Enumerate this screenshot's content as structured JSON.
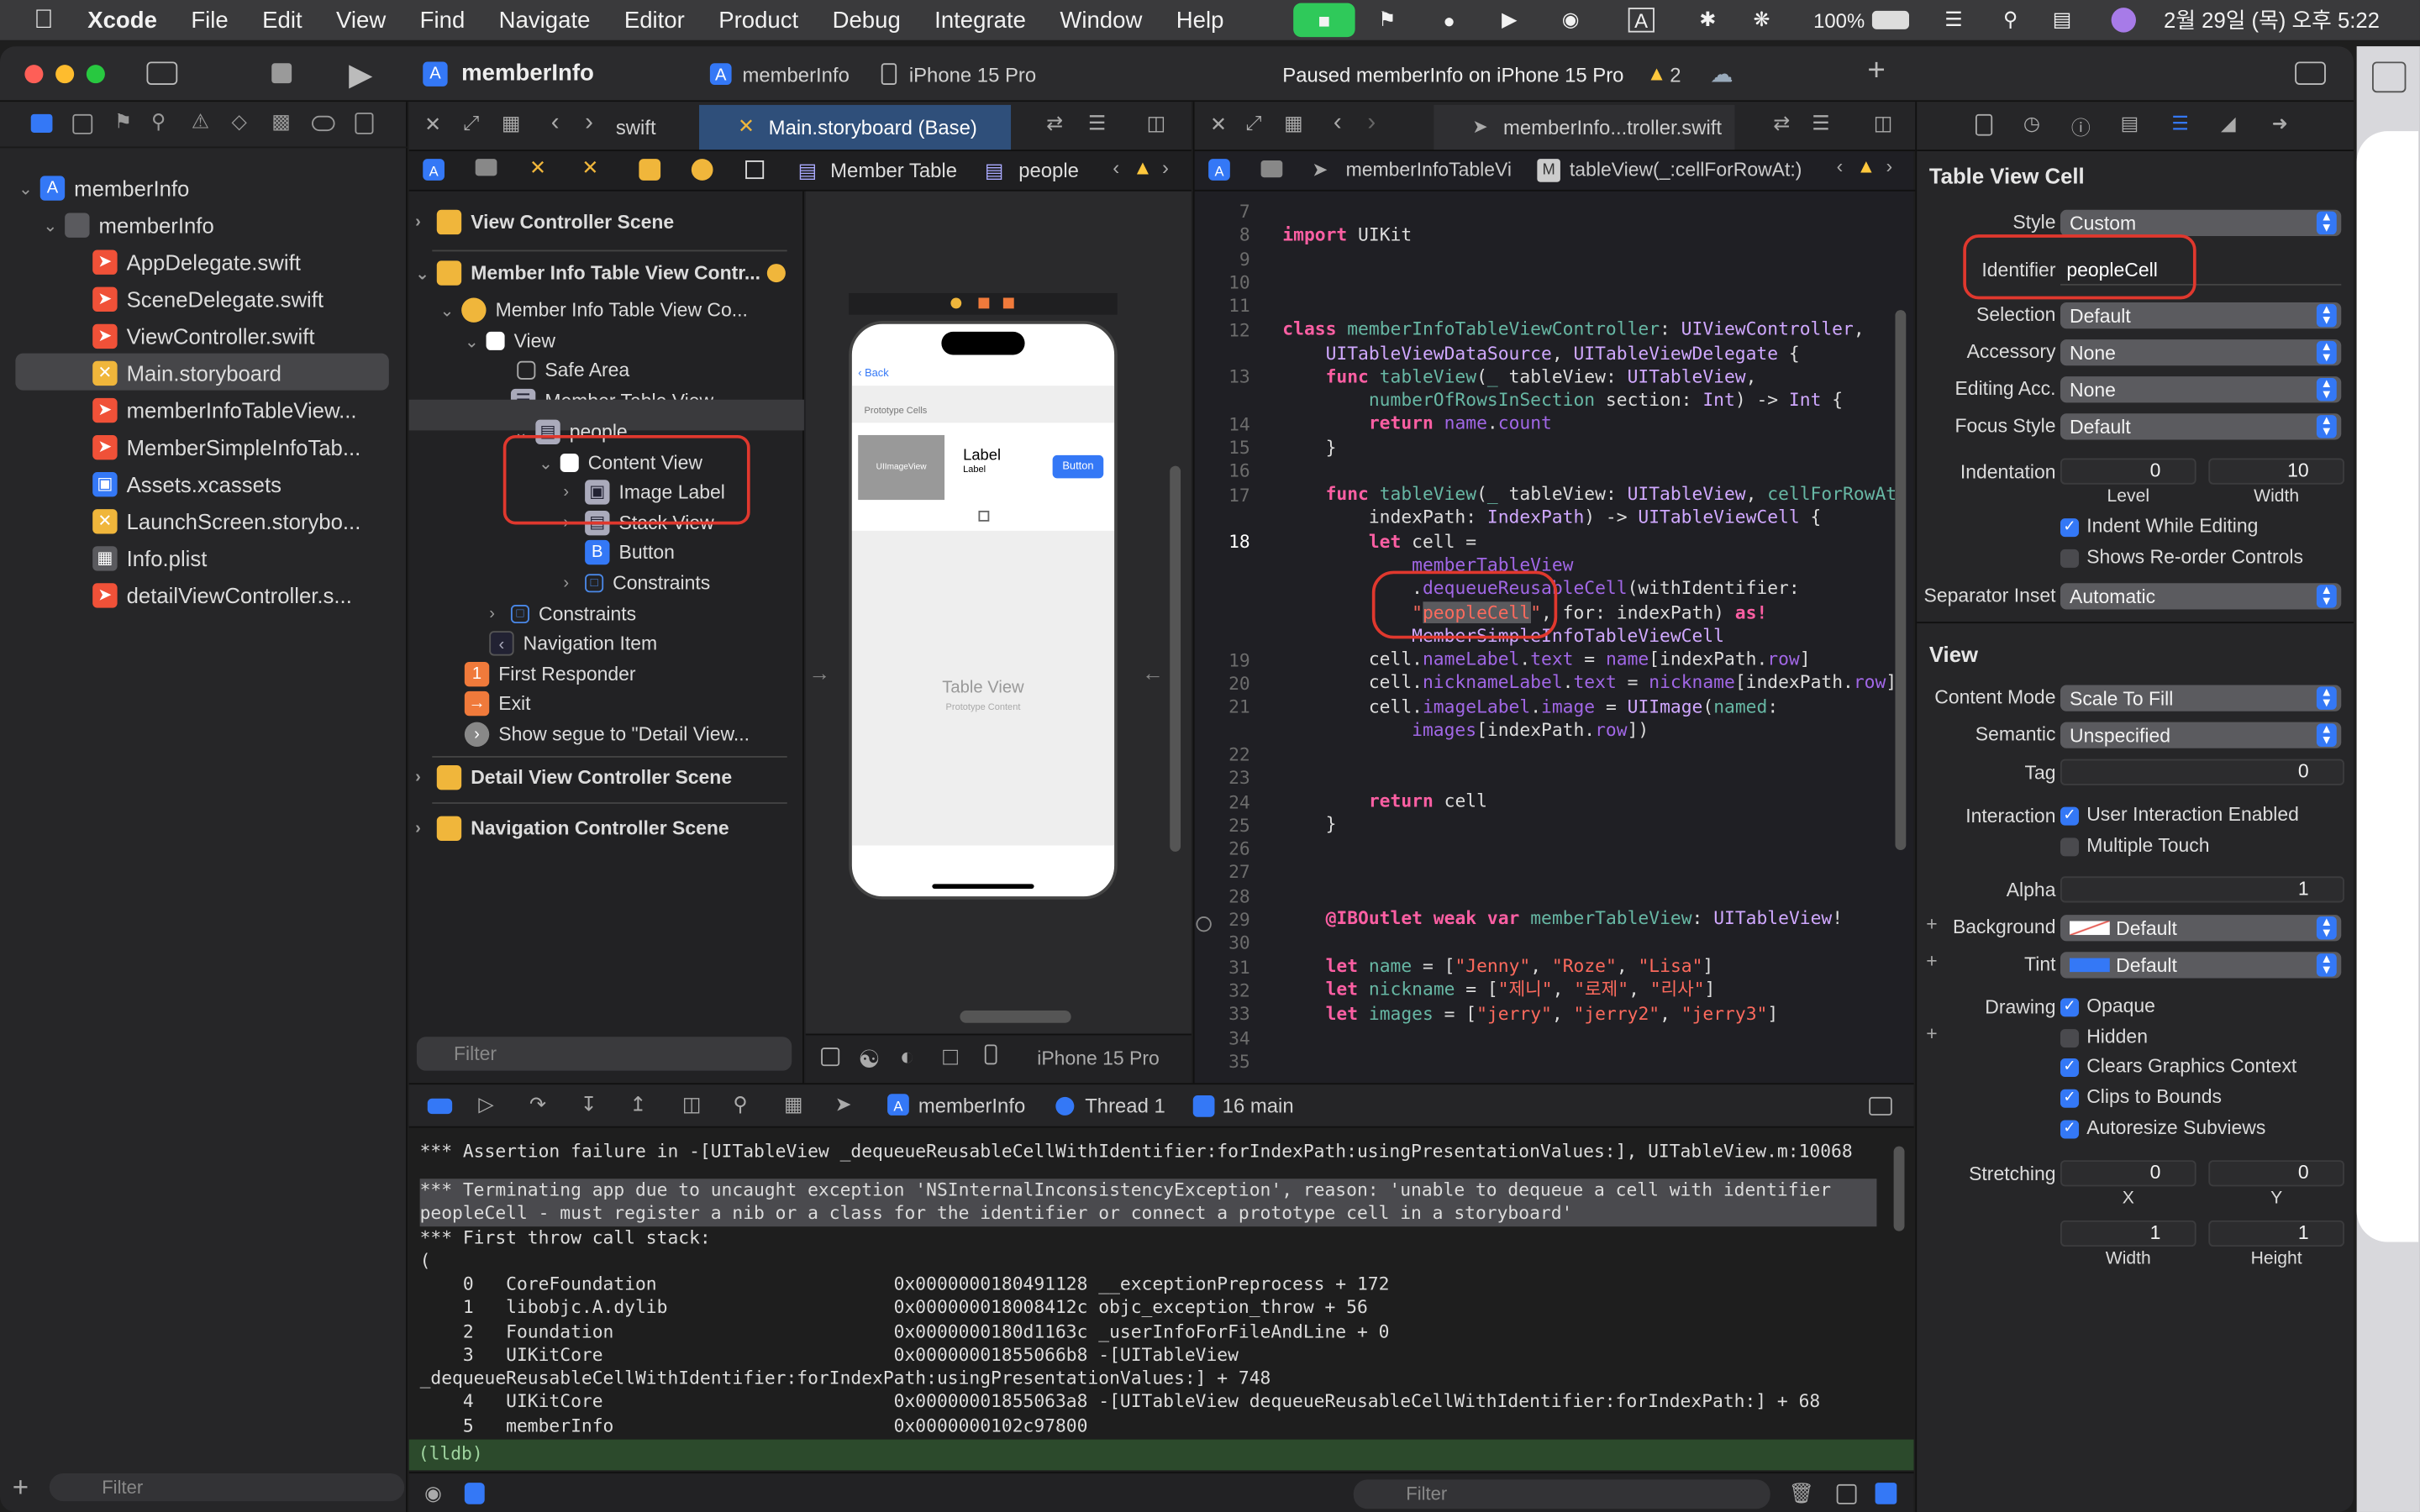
{
  "menubar": {
    "app": "Xcode",
    "items": [
      "File",
      "Edit",
      "View",
      "Find",
      "Navigate",
      "Editor",
      "Product",
      "Debug",
      "Integrate",
      "Window",
      "Help"
    ],
    "battery": "100%",
    "datetime": "2월 29일 (목) 오후 5:22"
  },
  "toolbar": {
    "project": "memberInfo",
    "scheme": "memberInfo",
    "device": "iPhone 15 Pro",
    "status": "Paused memberInfo on iPhone 15 Pro",
    "warnings": "2"
  },
  "navigator": {
    "items": [
      {
        "label": "memberInfo"
      },
      {
        "label": "memberInfo"
      },
      {
        "label": "AppDelegate.swift"
      },
      {
        "label": "SceneDelegate.swift"
      },
      {
        "label": "ViewController.swift"
      },
      {
        "label": "Main.storyboard"
      },
      {
        "label": "memberInfoTableView..."
      },
      {
        "label": "MemberSimpleInfoTab..."
      },
      {
        "label": "Assets.xcassets"
      },
      {
        "label": "LaunchScreen.storybo..."
      },
      {
        "label": "Info.plist"
      },
      {
        "label": "detailViewController.s..."
      }
    ],
    "filter_placeholder": "Filter"
  },
  "storyboard_editor": {
    "tabs": [
      "swift",
      "Main.storyboard (Base)"
    ],
    "jump_bar": [
      "Member Table",
      "people"
    ],
    "outline": [
      "View Controller Scene",
      "Member Info Table View Contr...",
      "Member Info Table View Co...",
      "View",
      "Safe Area",
      "Member Table View",
      "people",
      "Content View",
      "Image Label",
      "Stack View",
      "Button",
      "Constraints",
      "Constraints",
      "Navigation Item",
      "First Responder",
      "Exit",
      "Show segue to \"Detail View...",
      "Detail View Controller Scene",
      "Navigation Controller Scene"
    ],
    "filter_placeholder": "Filter",
    "canvas": {
      "back": "Back",
      "prototype_cells": "Prototype Cells",
      "image_label": "UIImageView",
      "label1": "Label",
      "label2": "Label",
      "button": "Button",
      "table_view": "Table View",
      "prototype_content": "Prototype Content",
      "device": "iPhone 15 Pro"
    }
  },
  "code_editor": {
    "tab": "memberInfo...troller.swift",
    "jump_bar": [
      "memberInfoTableVi",
      "tableView(_:cellForRowAt:)"
    ],
    "line_numbers": [
      "7",
      "8",
      "9",
      "10",
      "11",
      "12",
      "",
      "13",
      "",
      "14",
      "15",
      "16",
      "17",
      "",
      "18",
      "",
      "",
      "",
      "",
      "19",
      "20",
      "21",
      "",
      "22",
      "23",
      "24",
      "25",
      "26",
      "27",
      "28",
      "29",
      "30",
      "31",
      "32",
      "33",
      "34",
      "35"
    ]
  },
  "debug": {
    "bar": [
      "memberInfo",
      "Thread 1",
      "16 main"
    ],
    "log": [
      "*** Assertion failure in -[UITableView _dequeueReusableCellWithIdentifier:forIndexPath:usingPresentationValues:], UITableView.m:10068",
      "*** Terminating app due to uncaught exception 'NSInternalInconsistencyException', reason: 'unable to dequeue a cell with identifier",
      "peopleCell - must register a nib or a class for the identifier or connect a prototype cell in a storyboard'",
      "*** First throw call stack:",
      "(",
      "    0   CoreFoundation                      0x0000000180491128 __exceptionPreprocess + 172",
      "    1   libobjc.A.dylib                     0x000000018008412c objc_exception_throw + 56",
      "    2   Foundation                          0x0000000180d1163c _userInfoForFileAndLine + 0",
      "    3   UIKitCore                           0x00000001855066b8 -[UITableView",
      "_dequeueReusableCellWithIdentifier:forIndexPath:usingPresentationValues:] + 748",
      "    4   UIKitCore                           0x00000001855063a8 -[UITableView dequeueReusableCellWithIdentifier:forIndexPath:] + 68",
      "    5   memberInfo                          0x0000000102c97800"
    ],
    "prompt": "(lldb)",
    "filter_placeholder": "Filter"
  },
  "inspector": {
    "title": "Table View Cell",
    "style": {
      "label": "Style",
      "value": "Custom"
    },
    "identifier": {
      "label": "Identifier",
      "value": "peopleCell"
    },
    "selection": {
      "label": "Selection",
      "value": "Default"
    },
    "accessory": {
      "label": "Accessory",
      "value": "None"
    },
    "editing_acc": {
      "label": "Editing Acc.",
      "value": "None"
    },
    "focus_style": {
      "label": "Focus Style",
      "value": "Default"
    },
    "indentation": {
      "label": "Indentation",
      "level": "0",
      "width": "10",
      "level_label": "Level",
      "width_label": "Width"
    },
    "indent_while_editing": "Indent While Editing",
    "shows_reorder": "Shows Re-order Controls",
    "separator_inset": {
      "label": "Separator Inset",
      "value": "Automatic"
    },
    "view_title": "View",
    "content_mode": {
      "label": "Content Mode",
      "value": "Scale To Fill"
    },
    "semantic": {
      "label": "Semantic",
      "value": "Unspecified"
    },
    "tag": {
      "label": "Tag",
      "value": "0"
    },
    "interaction": {
      "label": "Interaction",
      "opt1": "User Interaction Enabled",
      "opt2": "Multiple Touch"
    },
    "alpha": {
      "label": "Alpha",
      "value": "1"
    },
    "background": {
      "label": "Background",
      "value": "Default"
    },
    "tint": {
      "label": "Tint",
      "value": "Default"
    },
    "drawing": {
      "label": "Drawing",
      "opts": [
        "Opaque",
        "Hidden",
        "Clears Graphics Context",
        "Clips to Bounds",
        "Autoresize Subviews"
      ]
    },
    "stretching": {
      "label": "Stretching",
      "x": "0",
      "y": "0",
      "w": "1",
      "h": "1",
      "x_label": "X",
      "y_label": "Y",
      "w_label": "Width",
      "h_label": "Height"
    }
  },
  "colors": {
    "accent": "#3478f6",
    "annotation": "#e0382e"
  }
}
